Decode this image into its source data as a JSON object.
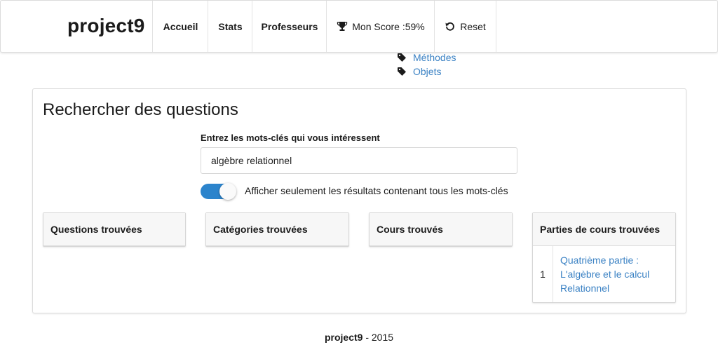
{
  "navbar": {
    "brand": "project9",
    "items": [
      {
        "label": "Accueil"
      },
      {
        "label": "Stats"
      },
      {
        "label": "Professeurs"
      },
      {
        "label": "Mon Score :59%",
        "icon": "trophy-icon"
      },
      {
        "label": "Reset",
        "icon": "undo-icon"
      }
    ]
  },
  "tags": [
    {
      "label": "Méthodes",
      "icon": "tag-icon"
    },
    {
      "label": "Objets",
      "icon": "tag-icon"
    }
  ],
  "search": {
    "title": "Rechercher des questions",
    "label": "Entrez les mots-clés qui vous intéressent",
    "value": "algèbre relationnel",
    "toggle_on": true,
    "toggle_label": "Afficher seulement les résultats contenant tous les mots-clés",
    "accent": "#2c84cc"
  },
  "results": {
    "questions": {
      "title": "Questions trouvées"
    },
    "categories": {
      "title": "Catégories trouvées"
    },
    "cours": {
      "title": "Cours trouvés"
    },
    "parties": {
      "title": "Parties de cours trouvées",
      "rows": [
        {
          "num": "1",
          "line1": "Quatrième partie :",
          "line2": "L'algèbre et le calcul",
          "line3": "Relationnel"
        }
      ]
    }
  },
  "footer": {
    "brand": "project9",
    "year": " - 2015"
  },
  "colors": {
    "link": "#3b82c4",
    "text": "#1b1b1b"
  }
}
